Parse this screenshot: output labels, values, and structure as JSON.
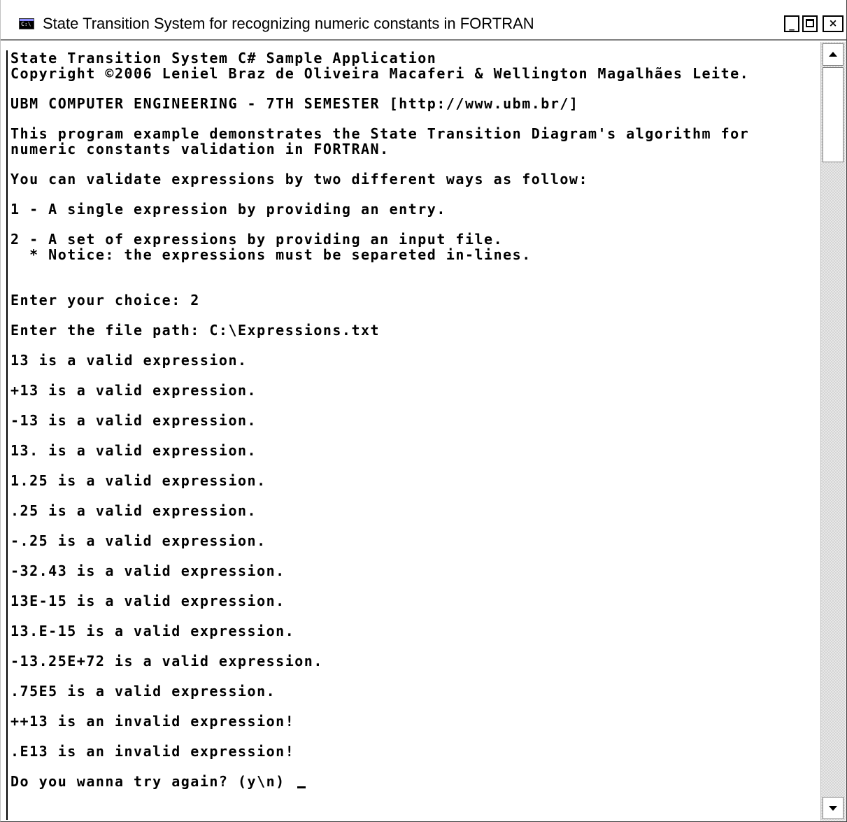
{
  "window": {
    "title": "State Transition System for recognizing numeric constants in FORTRAN",
    "icon": "console-icon",
    "controls": {
      "minimize": "_",
      "maximize": "□",
      "close": "×"
    }
  },
  "console": {
    "lines": [
      {
        "text": "State Transition System C# Sample Application",
        "gap": "none"
      },
      {
        "text": "Copyright ©2006 Leniel Braz de Oliveira Macaferi & Wellington Magalhães Leite.",
        "gap": "none"
      },
      {
        "text": "UBM COMPUTER ENGINEERING - 7TH SEMESTER [http://www.ubm.br/]",
        "gap": "small"
      },
      {
        "text": "This program example demonstrates the State Transition Diagram's algorithm for",
        "gap": "small"
      },
      {
        "text": "numeric constants validation in FORTRAN.",
        "gap": "none"
      },
      {
        "text": "You can validate expressions by two different ways as follow:",
        "gap": "small"
      },
      {
        "text": "1 - A single expression by providing an entry.",
        "gap": "small"
      },
      {
        "text": "2 - A set of expressions by providing an input file.",
        "gap": "small"
      },
      {
        "text": "  * Notice: the expressions must be separeted in-lines.",
        "gap": "none"
      },
      {
        "text": "Enter your choice: 2",
        "gap": "large"
      },
      {
        "text": "Enter the file path: C:\\Expressions.txt",
        "gap": "small"
      },
      {
        "text": "13 is a valid expression.",
        "gap": "small"
      },
      {
        "text": "+13 is a valid expression.",
        "gap": "small"
      },
      {
        "text": "-13 is a valid expression.",
        "gap": "small"
      },
      {
        "text": "13. is a valid expression.",
        "gap": "small"
      },
      {
        "text": "1.25 is a valid expression.",
        "gap": "small"
      },
      {
        "text": ".25 is a valid expression.",
        "gap": "small"
      },
      {
        "text": "-.25 is a valid expression.",
        "gap": "small"
      },
      {
        "text": "-32.43 is a valid expression.",
        "gap": "small"
      },
      {
        "text": "13E-15 is a valid expression.",
        "gap": "small"
      },
      {
        "text": "13.E-15 is a valid expression.",
        "gap": "small"
      },
      {
        "text": "-13.25E+72 is a valid expression.",
        "gap": "small"
      },
      {
        "text": ".75E5 is a valid expression.",
        "gap": "small"
      },
      {
        "text": "++13 is an invalid expression!",
        "gap": "small"
      },
      {
        "text": ".E13 is an invalid expression!",
        "gap": "small"
      }
    ],
    "prompt": "Do you wanna try again? (y\\n) "
  },
  "scrollbar": {
    "up_icon": "scroll-up-arrow-icon",
    "down_icon": "scroll-down-arrow-icon"
  }
}
